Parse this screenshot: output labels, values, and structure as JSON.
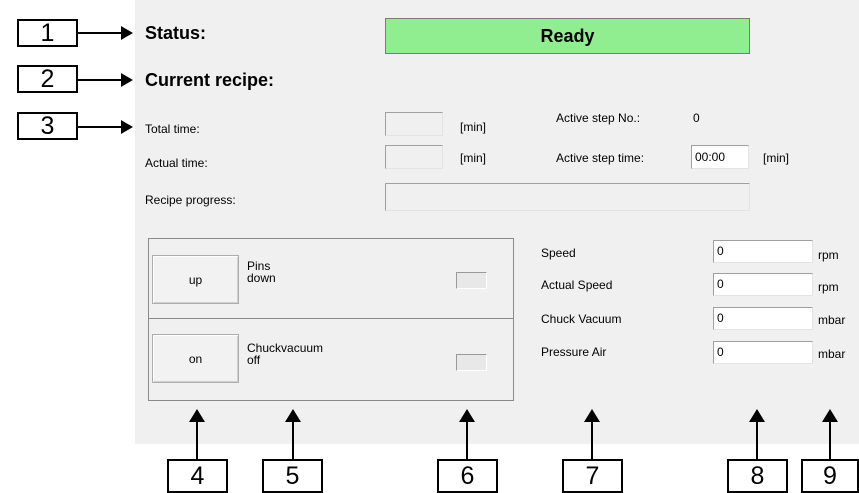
{
  "callouts": [
    "1",
    "2",
    "3",
    "4",
    "5",
    "6",
    "7",
    "8",
    "9"
  ],
  "status": {
    "label": "Status:",
    "value": "Ready",
    "color": "#90ee90"
  },
  "recipe": {
    "label": "Current recipe:"
  },
  "total_time": {
    "label": "Total time:",
    "value": "",
    "unit": "[min]"
  },
  "actual_time": {
    "label": "Actual time:",
    "value": "",
    "unit": "[min]"
  },
  "active_step_no": {
    "label": "Active step No.:",
    "value": "0"
  },
  "active_step_time": {
    "label": "Active step time:",
    "value": "00:00",
    "unit": "[min]"
  },
  "recipe_progress": {
    "label": "Recipe progress:",
    "value": 0
  },
  "pins": {
    "button": "up",
    "label_line1": "Pins",
    "label_line2": "down",
    "led": "off"
  },
  "chuck": {
    "button": "on",
    "label_line1": "Chuckvacuum",
    "label_line2": "off",
    "led": "off"
  },
  "readouts": [
    {
      "label": "Speed",
      "value": "0",
      "unit": "rpm"
    },
    {
      "label": "Actual Speed",
      "value": "0",
      "unit": "rpm"
    },
    {
      "label": "Chuck Vacuum",
      "value": "0",
      "unit": "mbar"
    },
    {
      "label": "Pressure Air",
      "value": "0",
      "unit": "mbar"
    }
  ]
}
